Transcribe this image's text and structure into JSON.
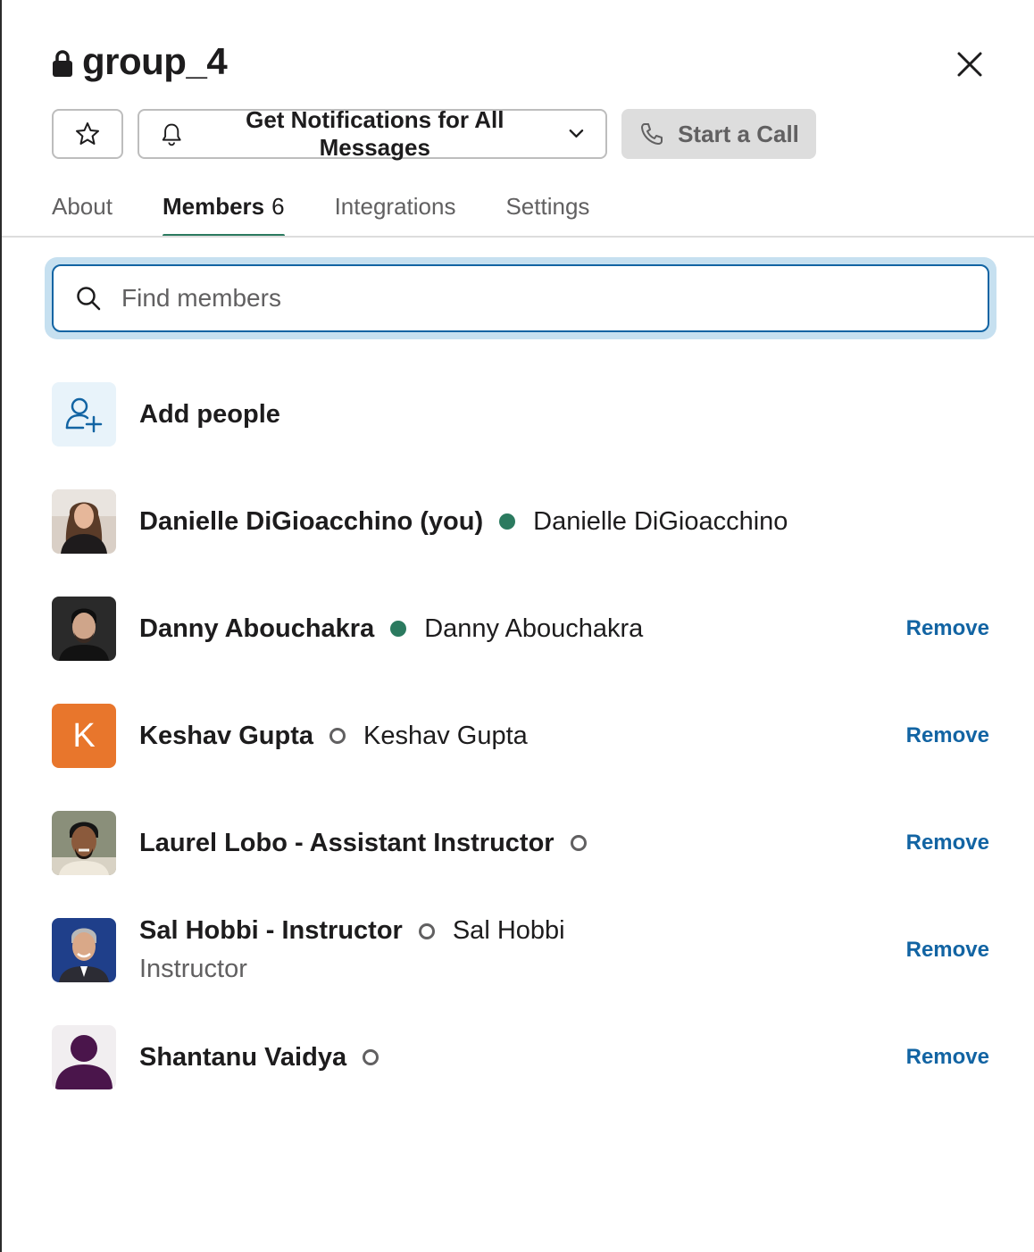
{
  "channel": {
    "name": "group_4"
  },
  "toolbar": {
    "notifications_label": "Get Notifications for All Messages",
    "call_label": "Start a Call"
  },
  "tabs": [
    {
      "label": "About"
    },
    {
      "label": "Members",
      "count": "6"
    },
    {
      "label": "Integrations"
    },
    {
      "label": "Settings"
    }
  ],
  "search": {
    "placeholder": "Find members",
    "value": ""
  },
  "add_people": {
    "label": "Add people"
  },
  "members": [
    {
      "name": "Danielle DiGioacchino (you)",
      "status": "active",
      "display_name": "Danielle DiGioacchino",
      "subtitle": "",
      "avatar": "photo",
      "remove_label": ""
    },
    {
      "name": "Danny Abouchakra",
      "status": "active",
      "display_name": "Danny Abouchakra",
      "subtitle": "",
      "avatar": "photo",
      "remove_label": "Remove"
    },
    {
      "name": "Keshav Gupta",
      "status": "away",
      "display_name": "Keshav Gupta",
      "subtitle": "",
      "avatar": "letter",
      "avatar_letter": "K",
      "avatar_color": "#e8762c",
      "remove_label": "Remove"
    },
    {
      "name": "Laurel Lobo - Assistant Instructor",
      "status": "away",
      "display_name": "",
      "subtitle": "",
      "avatar": "photo",
      "remove_label": "Remove"
    },
    {
      "name": "Sal Hobbi - Instructor",
      "status": "away",
      "display_name": "Sal Hobbi",
      "subtitle": "Instructor",
      "avatar": "photo",
      "remove_label": "Remove"
    },
    {
      "name": "Shantanu Vaidya",
      "status": "away",
      "display_name": "",
      "subtitle": "",
      "avatar": "default",
      "remove_label": "Remove"
    }
  ],
  "colors": {
    "accent_tab": "#2b7a5f",
    "link": "#1264a3",
    "presence_active": "#2b7a5f",
    "focus_ring": "#c6e0f0"
  }
}
